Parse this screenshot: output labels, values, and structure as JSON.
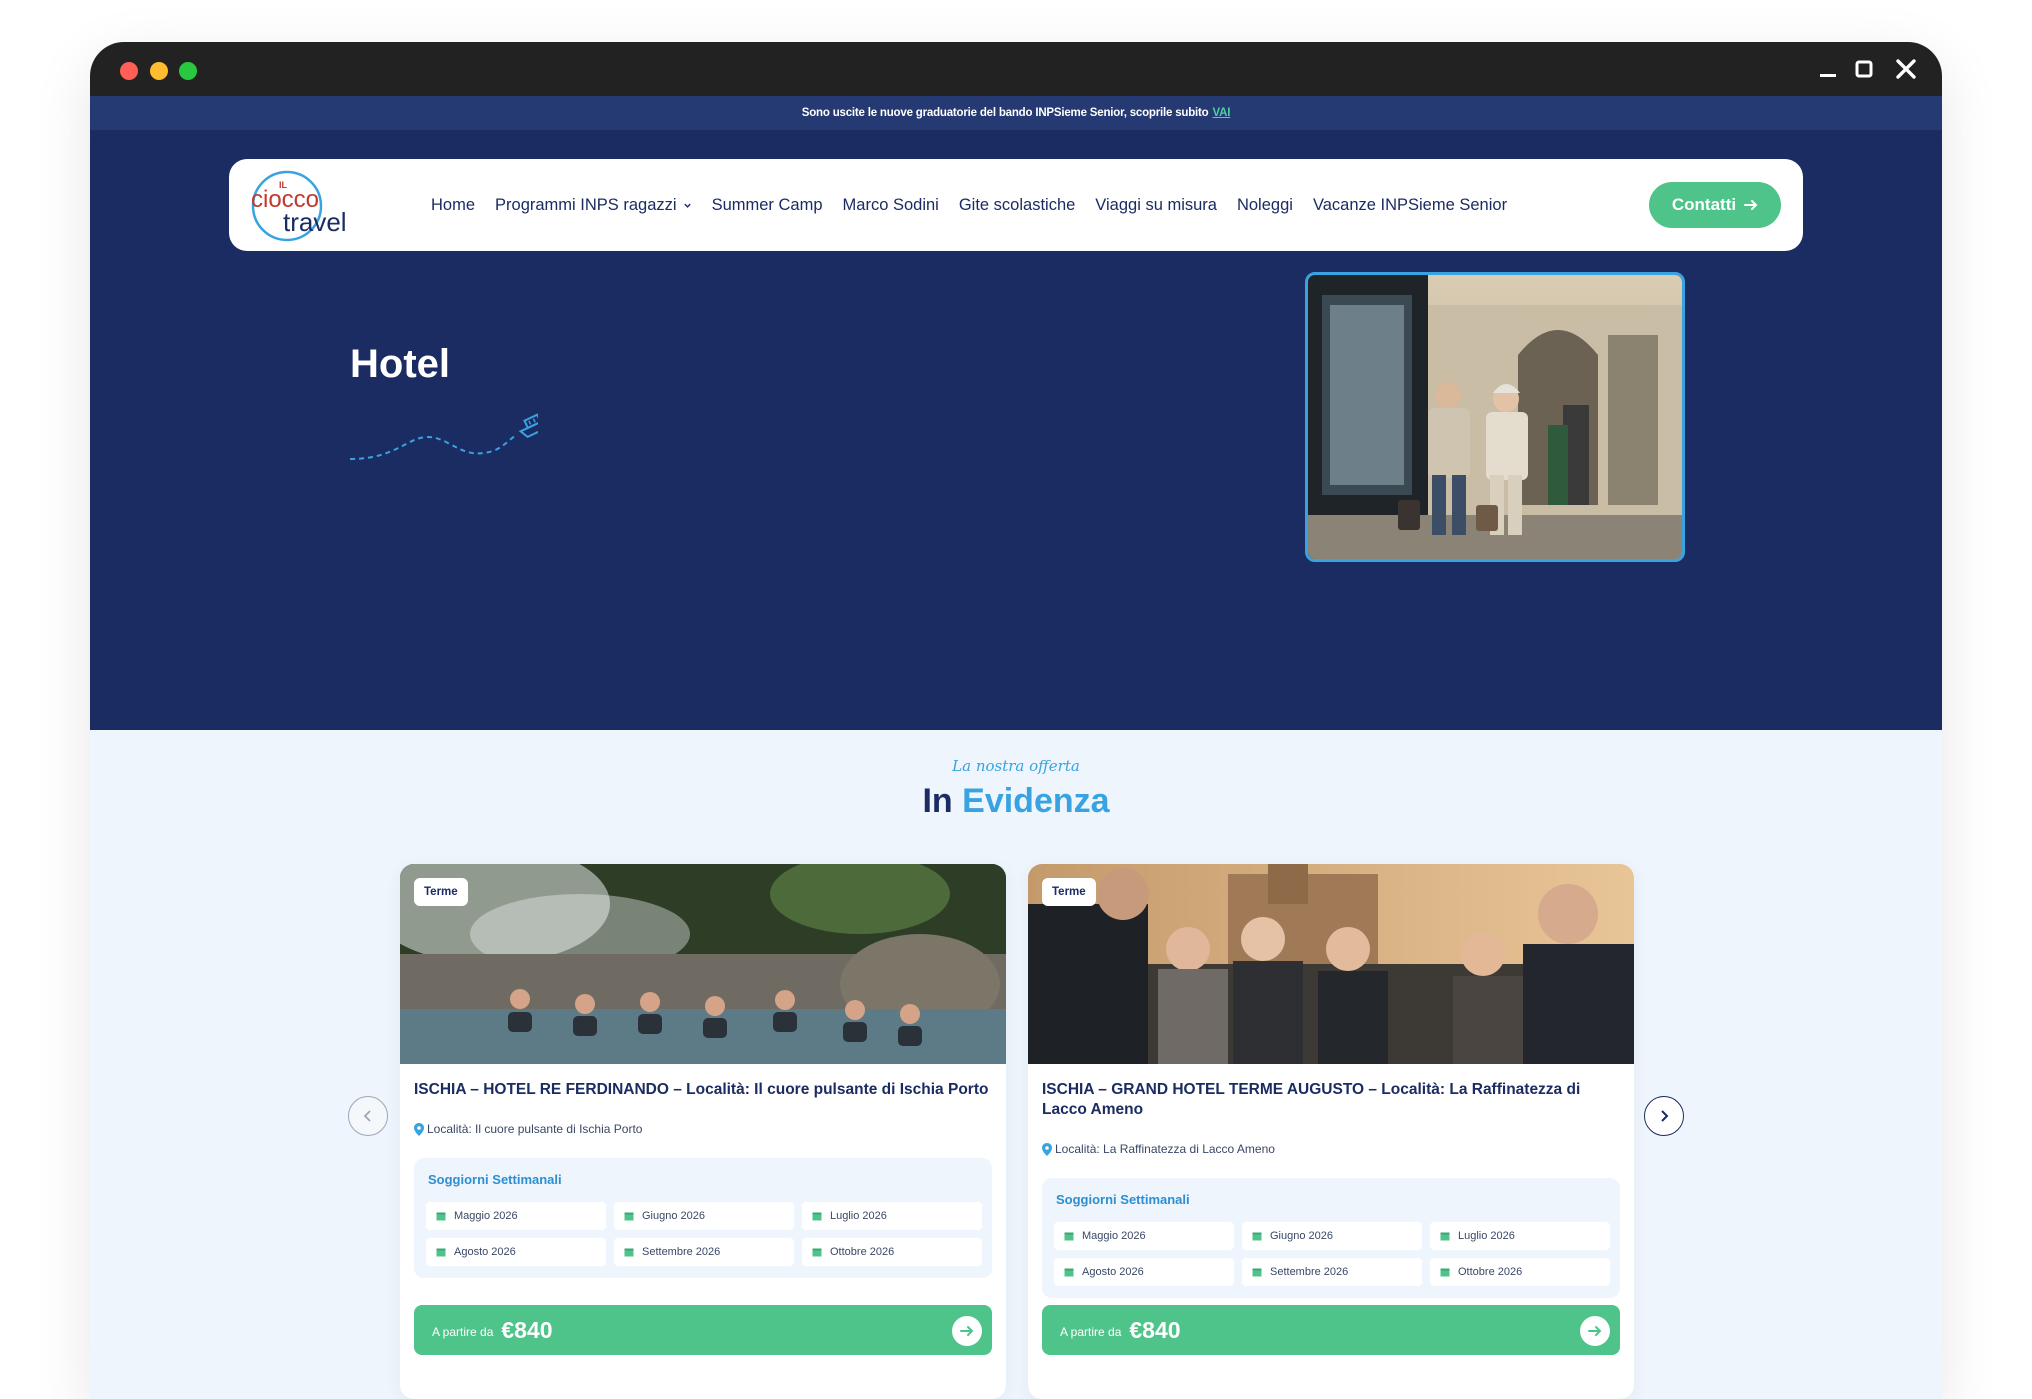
{
  "announcement": {
    "text": "Sono uscite le nuove graduatorie del bando INPSieme Senior, scoprile subito",
    "link": "VAI"
  },
  "brand": {
    "logo_small": "IL",
    "logo_line1": "ciocco",
    "logo_line2": "travel"
  },
  "nav": {
    "items": [
      "Home",
      "Programmi INPS ragazzi",
      "Summer Camp",
      "Marco Sodini",
      "Gite scolastiche",
      "Viaggi su misura",
      "Noleggi",
      "Vacanze INPSieme Senior"
    ],
    "contact": "Contatti"
  },
  "hero": {
    "title": "Hotel"
  },
  "section": {
    "script": "La nostra offerta",
    "title_part1": "In",
    "title_part2": "Evidenza"
  },
  "cards": [
    {
      "badge": "Terme",
      "title": "ISCHIA – HOTEL RE FERDINANDO – Località: Il cuore pulsante di Ischia Porto",
      "location": "Località: Il cuore pulsante di Ischia Porto",
      "soggiorni_label": "Soggiorni Settimanali",
      "months": [
        "Maggio 2026",
        "Giugno 2026",
        "Luglio 2026",
        "Agosto 2026",
        "Settembre 2026",
        "Ottobre 2026"
      ],
      "price_from": "A partire da",
      "price": "€840"
    },
    {
      "badge": "Terme",
      "title": "ISCHIA – GRAND HOTEL TERME AUGUSTO – Località: La Raffinatezza di Lacco Ameno",
      "location": "Località: La Raffinatezza di Lacco Ameno",
      "soggiorni_label": "Soggiorni Settimanali",
      "months": [
        "Maggio 2026",
        "Giugno 2026",
        "Luglio 2026",
        "Agosto 2026",
        "Settembre 2026",
        "Ottobre 2026"
      ],
      "price_from": "A partire da",
      "price": "€840"
    }
  ],
  "colors": {
    "navy": "#1b2c63",
    "accent": "#38a3e0",
    "green": "#4fc48a",
    "bg": "#eef5fc"
  },
  "icons": [
    "close-icon",
    "maximize-icon",
    "minimize-icon",
    "arrow-right-icon",
    "chevron-down-icon",
    "boat-icon",
    "location-pin-icon",
    "calendar-icon",
    "chevron-left-icon",
    "chevron-right-icon"
  ]
}
